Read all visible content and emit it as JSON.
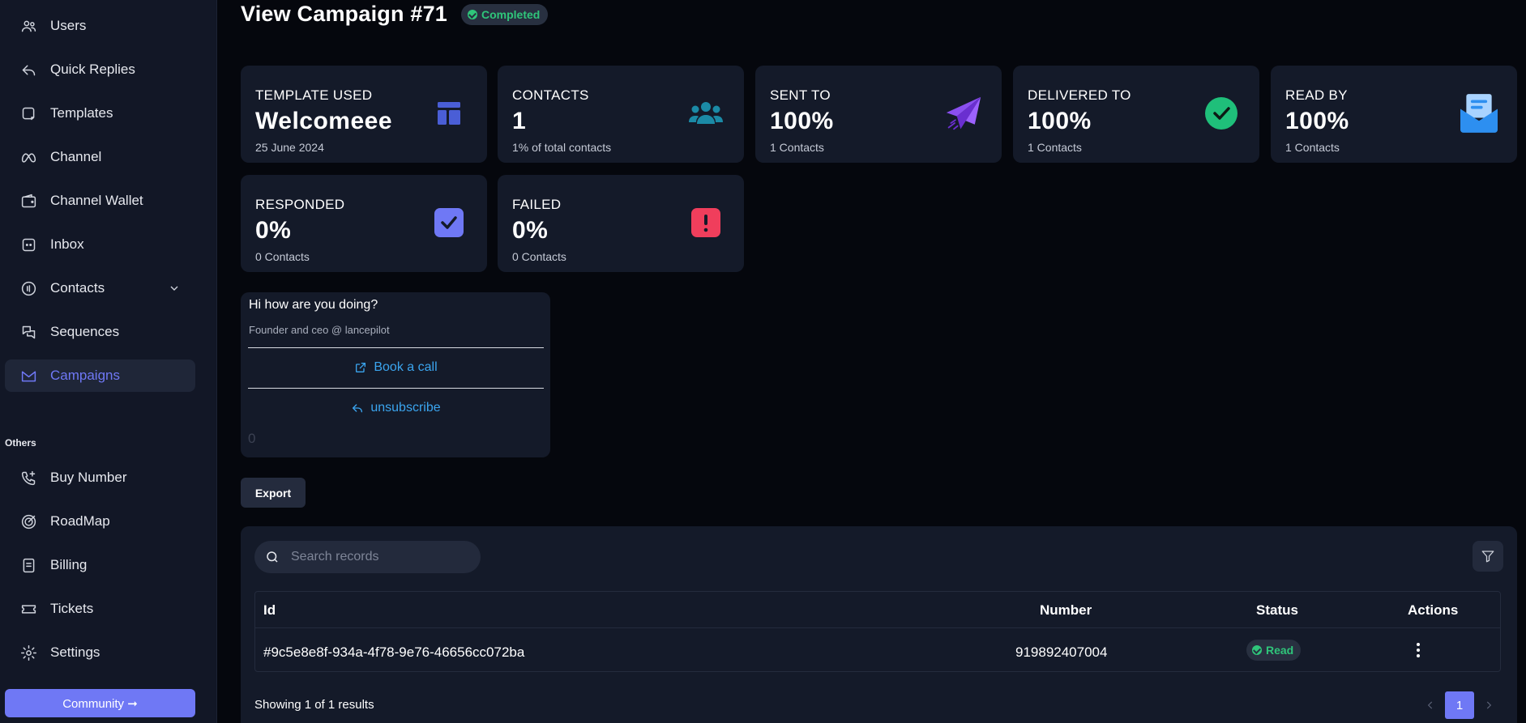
{
  "sidebar": {
    "items": [
      {
        "label": "Users",
        "icon": "users-icon"
      },
      {
        "label": "Quick Replies",
        "icon": "reply-icon"
      },
      {
        "label": "Templates",
        "icon": "template-icon"
      },
      {
        "label": "Channel",
        "icon": "meta-icon"
      },
      {
        "label": "Channel Wallet",
        "icon": "wallet-icon"
      },
      {
        "label": "Inbox",
        "icon": "inbox-icon"
      },
      {
        "label": "Contacts",
        "icon": "contacts-icon"
      },
      {
        "label": "Sequences",
        "icon": "sequences-icon"
      },
      {
        "label": "Campaigns",
        "icon": "campaigns-icon",
        "active": true
      }
    ],
    "others_label": "Others",
    "others": [
      {
        "label": "Buy Number",
        "icon": "phone-plus-icon"
      },
      {
        "label": "RoadMap",
        "icon": "target-icon"
      },
      {
        "label": "Billing",
        "icon": "billing-icon"
      },
      {
        "label": "Tickets",
        "icon": "ticket-icon"
      },
      {
        "label": "Settings",
        "icon": "gear-icon"
      }
    ],
    "community_label": "Community ➞"
  },
  "header": {
    "title": "View Campaign #71",
    "status": "Completed"
  },
  "stats": [
    {
      "label": "TEMPLATE USED",
      "value": "Welcomeee",
      "sub": "25 June 2024",
      "icon": "template-layout-icon",
      "color": "#4a5ed6"
    },
    {
      "label": "CONTACTS",
      "value": "1",
      "sub": "1% of total contacts",
      "icon": "people-group-icon",
      "color": "#1b8aa6"
    },
    {
      "label": "SENT TO",
      "value": "100%",
      "sub": "1 Contacts",
      "icon": "paper-plane-icon",
      "color": "#7a3fe0"
    },
    {
      "label": "DELIVERED TO",
      "value": "100%",
      "sub": "1 Contacts",
      "icon": "check-circle-icon",
      "color": "#1fbf7a"
    },
    {
      "label": "READ BY",
      "value": "100%",
      "sub": "1 Contacts",
      "icon": "open-envelope-icon",
      "color": "#2d8ff0"
    },
    {
      "label": "RESPONDED",
      "value": "0%",
      "sub": "0 Contacts",
      "icon": "check-square-icon",
      "color": "#6f78f5"
    },
    {
      "label": "FAILED",
      "value": "0%",
      "sub": "0 Contacts",
      "icon": "alert-icon",
      "color": "#f03e5c"
    }
  ],
  "preview": {
    "message": "Hi how are you doing?",
    "footer": "Founder and ceo @ lancepilot",
    "button1": "Book a call",
    "button2": "unsubscribe",
    "counter": "0"
  },
  "export_label": "Export",
  "search": {
    "placeholder": "Search records"
  },
  "table": {
    "headers": {
      "id": "Id",
      "number": "Number",
      "status": "Status",
      "actions": "Actions"
    },
    "rows": [
      {
        "id": "#9c5e8e8f-934a-4f78-9e76-46656cc072ba",
        "number": "919892407004",
        "status": "Read"
      }
    ]
  },
  "pagination": {
    "results": "Showing 1 of 1 results",
    "current_page": "1"
  }
}
